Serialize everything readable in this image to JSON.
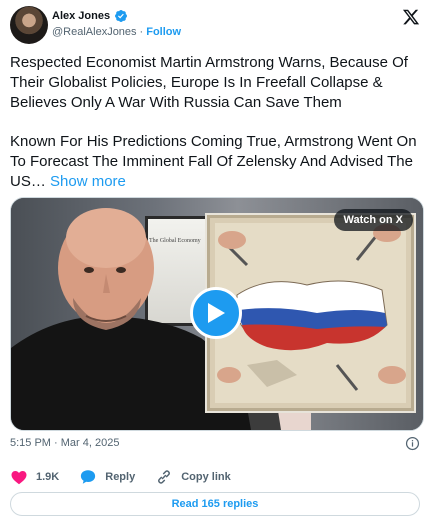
{
  "author": {
    "name": "Alex Jones",
    "handle": "@RealAlexJones",
    "separator": "·",
    "follow_label": "Follow",
    "verified": true
  },
  "tweet": {
    "paragraph_1": "Respected Economist Martin Armstrong Warns, Because Of Their Globalist Policies, Europe Is In Freefall Collapse & Believes Only A War With Russia Can Save Them",
    "paragraph_2": "Known For His Predictions Coming True, Armstrong Went On To Forecast The Imminent Fall Of Zelensky And Advised The US…",
    "show_more": "Show more"
  },
  "media": {
    "watch_label": "Watch on X",
    "monitor_text": "The Global Economy"
  },
  "meta": {
    "time": "5:15 PM",
    "separator": "·",
    "date": "Mar 4, 2025"
  },
  "actions": {
    "like_count": "1.9K",
    "reply_label": "Reply",
    "copy_label": "Copy link"
  },
  "replies_button": "Read 165 replies",
  "colors": {
    "accent": "#1d9bf0",
    "like": "#f91880",
    "text": "#0f1419",
    "muted": "#536471",
    "border": "#cfd9de"
  }
}
